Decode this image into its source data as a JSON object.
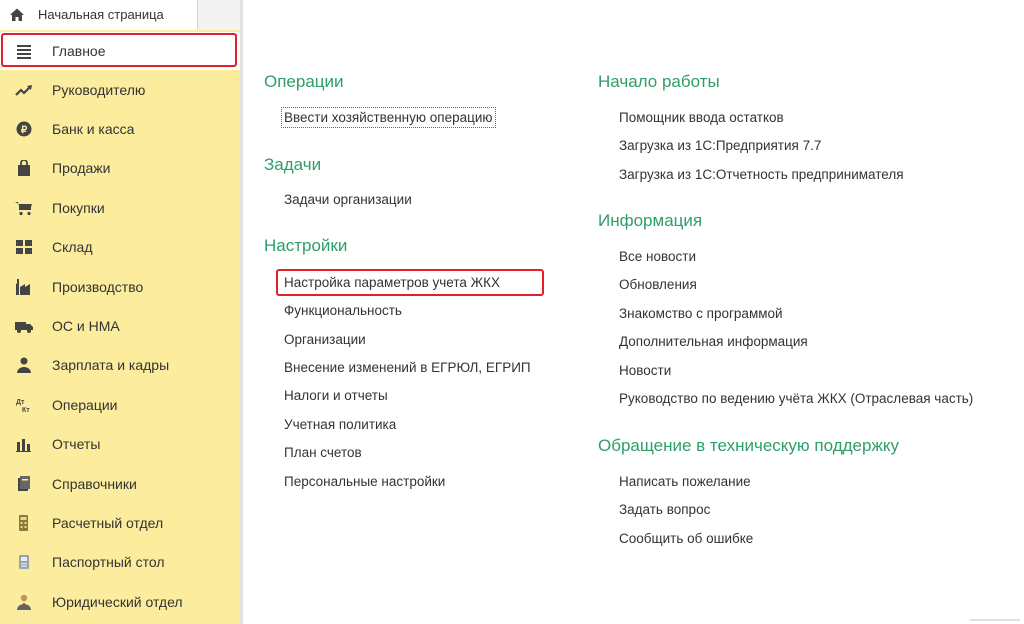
{
  "home_tab": {
    "label": "Начальная страница",
    "icon": "home-icon"
  },
  "sidebar": {
    "items": [
      {
        "label": "Главное",
        "icon": "menu-lines-icon"
      },
      {
        "label": "Руководителю",
        "icon": "trend-up-icon"
      },
      {
        "label": "Банк и касса",
        "icon": "ruble-coin-icon"
      },
      {
        "label": "Продажи",
        "icon": "shopping-bag-icon"
      },
      {
        "label": "Покупки",
        "icon": "cart-icon"
      },
      {
        "label": "Склад",
        "icon": "warehouse-grid-icon"
      },
      {
        "label": "Производство",
        "icon": "factory-icon"
      },
      {
        "label": "ОС и НМА",
        "icon": "truck-icon"
      },
      {
        "label": "Зарплата и кадры",
        "icon": "person-icon"
      },
      {
        "label": "Операции",
        "icon": "dt-kt-icon"
      },
      {
        "label": "Отчеты",
        "icon": "bar-chart-icon"
      },
      {
        "label": "Справочники",
        "icon": "books-icon"
      },
      {
        "label": "Расчетный отдел",
        "icon": "calculator-icon"
      },
      {
        "label": "Паспортный стол",
        "icon": "passport-icon"
      },
      {
        "label": "Юридический отдел",
        "icon": "lawyer-icon"
      }
    ]
  },
  "left_column": {
    "operations": {
      "title": "Операции",
      "links": [
        "Ввести хозяйственную операцию"
      ]
    },
    "tasks": {
      "title": "Задачи",
      "links": [
        "Задачи организации"
      ]
    },
    "settings": {
      "title": "Настройки",
      "links": [
        "Настройка параметров учета ЖКХ",
        "Функциональность",
        "Организации",
        "Внесение изменений в ЕГРЮЛ, ЕГРИП",
        "Налоги и отчеты",
        "Учетная политика",
        "План счетов",
        "Персональные настройки"
      ]
    }
  },
  "right_column": {
    "start": {
      "title": "Начало работы",
      "links": [
        "Помощник ввода остатков",
        "Загрузка из 1С:Предприятия 7.7",
        "Загрузка из 1С:Отчетность предпринимателя"
      ]
    },
    "info": {
      "title": "Информация",
      "links": [
        "Все новости",
        "Обновления",
        "Знакомство с программой",
        "Дополнительная информация",
        "Новости",
        "Руководство по ведению учёта ЖКХ (Отраслевая часть)"
      ]
    },
    "support": {
      "title": "Обращение в техническую поддержку",
      "links": [
        "Написать пожелание",
        "Задать вопрос",
        "Сообщить об ошибке"
      ]
    }
  },
  "colors": {
    "sidebar_bg": "#fbec9e",
    "section_title": "#2e9e6a",
    "highlight": "#e3202a"
  }
}
